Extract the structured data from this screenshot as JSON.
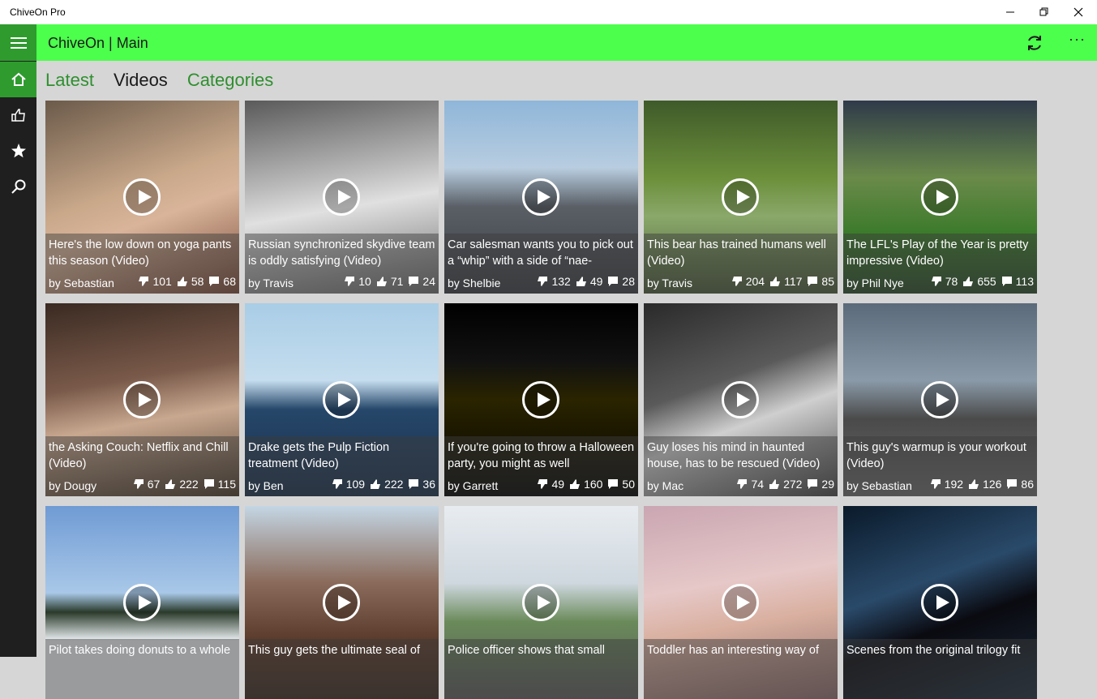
{
  "window": {
    "title": "ChiveOn Pro"
  },
  "appbar": {
    "title": "ChiveOn | Main"
  },
  "colors": {
    "accent": "#4cff4c",
    "accent_dark": "#2f9b2f",
    "sidebar": "#1f1f1f"
  },
  "nav": [
    {
      "icon": "home-icon"
    },
    {
      "icon": "thumbs-up-icon"
    },
    {
      "icon": "star-icon"
    },
    {
      "icon": "search-icon"
    }
  ],
  "tabs": [
    {
      "label": "Latest"
    },
    {
      "label": "Videos"
    },
    {
      "label": "Categories"
    }
  ],
  "tiles": [
    {
      "title": "Here's the low down on yoga pants this season (Video)",
      "by": "by Sebastian",
      "dislikes": "101",
      "likes": "58",
      "comments": "68"
    },
    {
      "title": "Russian synchronized skydive team is oddly satisfying (Video)",
      "by": "by Travis",
      "dislikes": "10",
      "likes": "71",
      "comments": "24"
    },
    {
      "title": "Car salesman wants you to pick out a “whip” with a side of “nae-",
      "by": "by Shelbie",
      "dislikes": "132",
      "likes": "49",
      "comments": "28"
    },
    {
      "title": "This bear has trained humans well (Video)",
      "by": "by Travis",
      "dislikes": "204",
      "likes": "117",
      "comments": "85"
    },
    {
      "title": "The LFL's Play of the Year is pretty impressive (Video)",
      "by": "by Phil Nye",
      "dislikes": "78",
      "likes": "655",
      "comments": "113"
    },
    {
      "title": "the Asking Couch: Netflix and Chill (Video)",
      "by": "by Dougy",
      "dislikes": "67",
      "likes": "222",
      "comments": "115"
    },
    {
      "title": "Drake gets the Pulp Fiction treatment (Video)",
      "by": "by Ben",
      "dislikes": "109",
      "likes": "222",
      "comments": "36"
    },
    {
      "title": "If you're going to throw a Halloween party, you might as well",
      "by": "by Garrett",
      "dislikes": "49",
      "likes": "160",
      "comments": "50"
    },
    {
      "title": "Guy loses his mind in haunted house, has to be rescued (Video)",
      "by": "by Mac",
      "dislikes": "74",
      "likes": "272",
      "comments": "29"
    },
    {
      "title": "This guy's warmup is your workout (Video)",
      "by": "by Sebastian",
      "dislikes": "192",
      "likes": "126",
      "comments": "86"
    },
    {
      "title": "Pilot takes doing donuts to a whole",
      "by": "",
      "dislikes": "",
      "likes": "",
      "comments": ""
    },
    {
      "title": "This guy gets the ultimate seal of",
      "by": "",
      "dislikes": "",
      "likes": "",
      "comments": ""
    },
    {
      "title": "Police officer shows that small",
      "by": "",
      "dislikes": "",
      "likes": "",
      "comments": ""
    },
    {
      "title": "Toddler has an interesting way of",
      "by": "",
      "dislikes": "",
      "likes": "",
      "comments": ""
    },
    {
      "title": "Scenes from the original trilogy fit",
      "by": "",
      "dislikes": "",
      "likes": "",
      "comments": ""
    }
  ]
}
